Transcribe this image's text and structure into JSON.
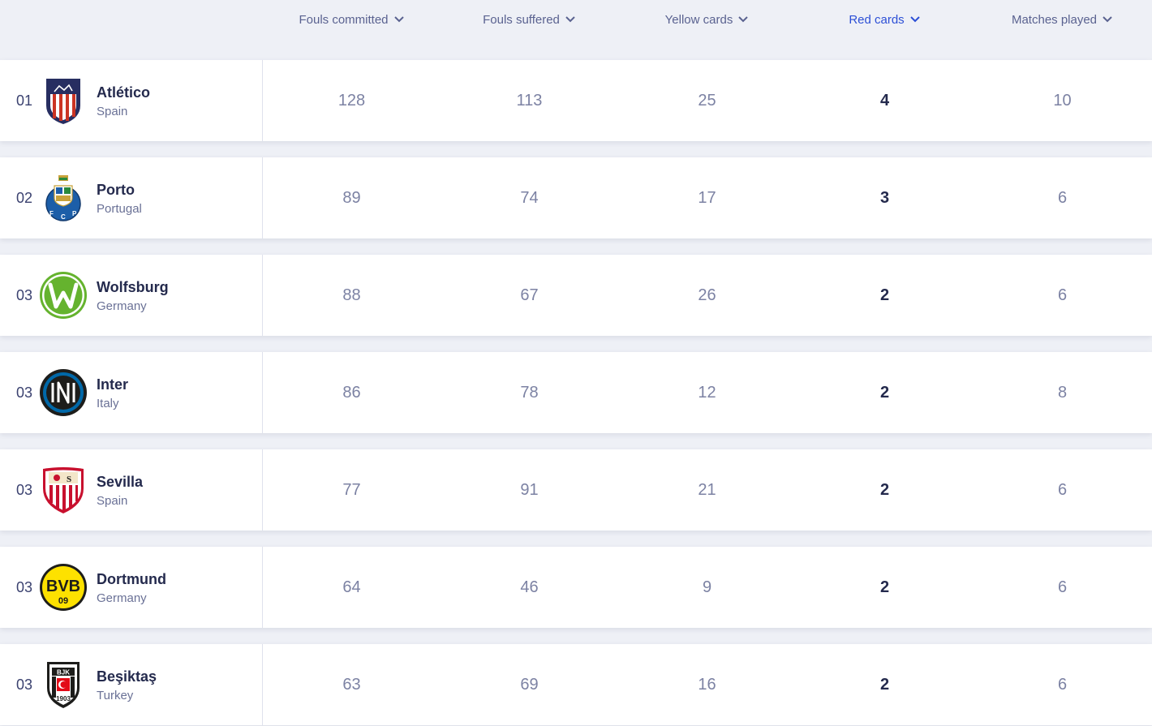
{
  "columns": [
    {
      "label": "Fouls committed",
      "active": false
    },
    {
      "label": "Fouls suffered",
      "active": false
    },
    {
      "label": "Yellow cards",
      "active": false
    },
    {
      "label": "Red cards",
      "active": true
    },
    {
      "label": "Matches played",
      "active": false
    }
  ],
  "rows": [
    {
      "rank": "01",
      "name": "Atlético",
      "country": "Spain",
      "logo": "atletico-crest-icon",
      "stats": [
        "128",
        "113",
        "25",
        "4",
        "10"
      ]
    },
    {
      "rank": "02",
      "name": "Porto",
      "country": "Portugal",
      "logo": "porto-crest-icon",
      "stats": [
        "89",
        "74",
        "17",
        "3",
        "6"
      ]
    },
    {
      "rank": "03",
      "name": "Wolfsburg",
      "country": "Germany",
      "logo": "wolfsburg-crest-icon",
      "stats": [
        "88",
        "67",
        "26",
        "2",
        "6"
      ]
    },
    {
      "rank": "03",
      "name": "Inter",
      "country": "Italy",
      "logo": "inter-crest-icon",
      "stats": [
        "86",
        "78",
        "12",
        "2",
        "8"
      ]
    },
    {
      "rank": "03",
      "name": "Sevilla",
      "country": "Spain",
      "logo": "sevilla-crest-icon",
      "stats": [
        "77",
        "91",
        "21",
        "2",
        "6"
      ]
    },
    {
      "rank": "03",
      "name": "Dortmund",
      "country": "Germany",
      "logo": "dortmund-crest-icon",
      "stats": [
        "64",
        "46",
        "9",
        "2",
        "6"
      ]
    },
    {
      "rank": "03",
      "name": "Beşiktaş",
      "country": "Turkey",
      "logo": "besiktas-crest-icon",
      "stats": [
        "63",
        "69",
        "16",
        "2",
        "6"
      ]
    }
  ],
  "colors": {
    "accent": "#2c4fd6",
    "text": "#242a4d",
    "muted": "#7c82a3",
    "background": "#eef0f6"
  }
}
